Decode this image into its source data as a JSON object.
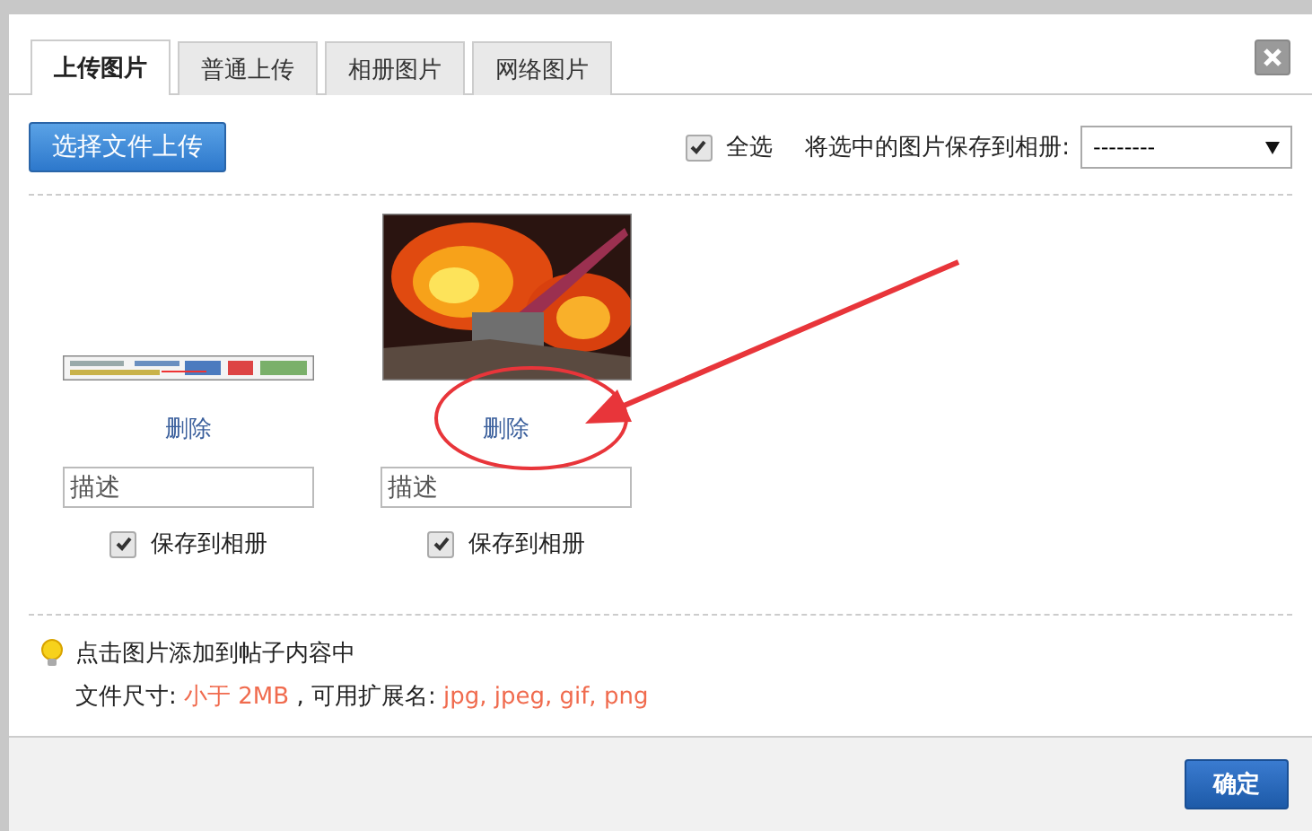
{
  "tabs": [
    {
      "label": "上传图片",
      "selected": true
    },
    {
      "label": "普通上传",
      "selected": false
    },
    {
      "label": "相册图片",
      "selected": false
    },
    {
      "label": "网络图片",
      "selected": false
    }
  ],
  "upload_button": "选择文件上传",
  "select_all": {
    "label": "全选",
    "checked": true
  },
  "save_to_album_label": "将选中的图片保存到相册:",
  "album_select": {
    "value": "--------"
  },
  "images": [
    {
      "kind": "wide",
      "delete": "删除",
      "placeholder": "描述",
      "save_label": "保存到相册",
      "checked": true
    },
    {
      "kind": "tall",
      "delete": "删除",
      "placeholder": "描述",
      "save_label": "保存到相册",
      "checked": true
    }
  ],
  "tip": "点击图片添加到帖子内容中",
  "limits": {
    "size_label": "文件尺寸:",
    "size_value": "小于 2MB",
    "ext_label": ", 可用扩展名:",
    "ext_value": "jpg, jpeg, gif, png"
  },
  "confirm_button": "确定"
}
